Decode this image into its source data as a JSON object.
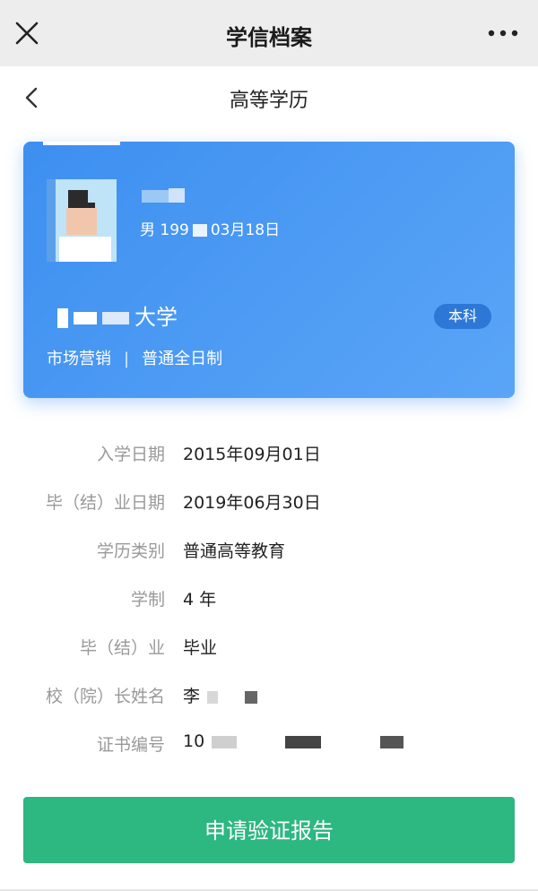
{
  "topbar": {
    "title": "学信档案",
    "close_icon": "close-icon",
    "more_icon": "more-horizontal-icon"
  },
  "navbar": {
    "title": "高等学历",
    "back_icon": "chevron-left-icon"
  },
  "card": {
    "gender_birth_prefix": "男  199",
    "gender_birth_suffix": "03月18日",
    "school_suffix": "大学",
    "degree": "本科",
    "major": "市场营销",
    "separator": "|",
    "study_mode": "普通全日制"
  },
  "info": [
    {
      "label": "入学日期",
      "value": "2015年09月01日"
    },
    {
      "label": "毕（结）业日期",
      "value": "2019年06月30日"
    },
    {
      "label": "学历类别",
      "value": "普通高等教育"
    },
    {
      "label": "学制",
      "value": "4 年"
    },
    {
      "label": "毕（结）业",
      "value": "毕业"
    },
    {
      "label": "校（院）长姓名",
      "value": "李"
    },
    {
      "label": "证书编号",
      "value": "10"
    }
  ],
  "apply_button": {
    "label": "申请验证报告"
  },
  "colors": {
    "card_gradient_start": "#3d8ff0",
    "card_gradient_end": "#5aa5f7",
    "badge": "#2d78d6",
    "button": "#2db781"
  }
}
